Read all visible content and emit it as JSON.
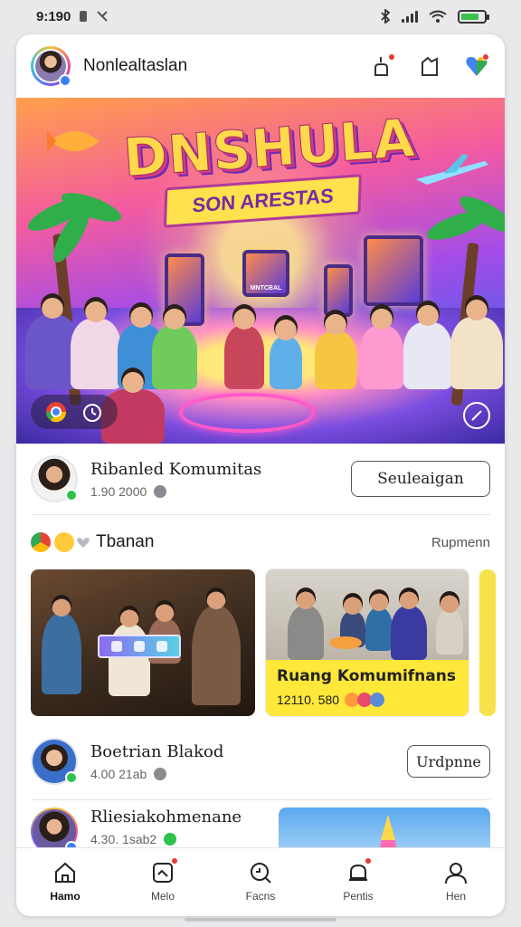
{
  "status": {
    "time": "9:190"
  },
  "header": {
    "title": "Nonlealtaslan"
  },
  "hero": {
    "title": "DNSHULA",
    "subtitle": "SON ARESTAS",
    "screen_label": "MNTCBAL"
  },
  "featured": {
    "name": "Ribanled Komumitas",
    "meta": "1.90  2000",
    "button": "Seuleaigan"
  },
  "section": {
    "title": "Tbanan",
    "link": "Rupmenn"
  },
  "cards": [
    {
      "title": ""
    },
    {
      "title": "Ruang Komumifnans",
      "meta": "12110. 580"
    }
  ],
  "rows": [
    {
      "name": "Boetrian Blakod",
      "meta": "4.00  21ab",
      "button": "Urdpnne"
    },
    {
      "name": "Rliesiakohmenane",
      "meta": "4.30. 1sab2"
    }
  ],
  "tabs": [
    {
      "label": "Hamo",
      "icon": "home-icon"
    },
    {
      "label": "Melo",
      "icon": "message-icon"
    },
    {
      "label": "Facns",
      "icon": "search-icon"
    },
    {
      "label": "Pentis",
      "icon": "notification-icon"
    },
    {
      "label": "Hen",
      "icon": "profile-icon"
    }
  ],
  "colors": {
    "accent": "#e53935",
    "online": "#2ec24a",
    "card_yellow": "#ffe83a"
  }
}
